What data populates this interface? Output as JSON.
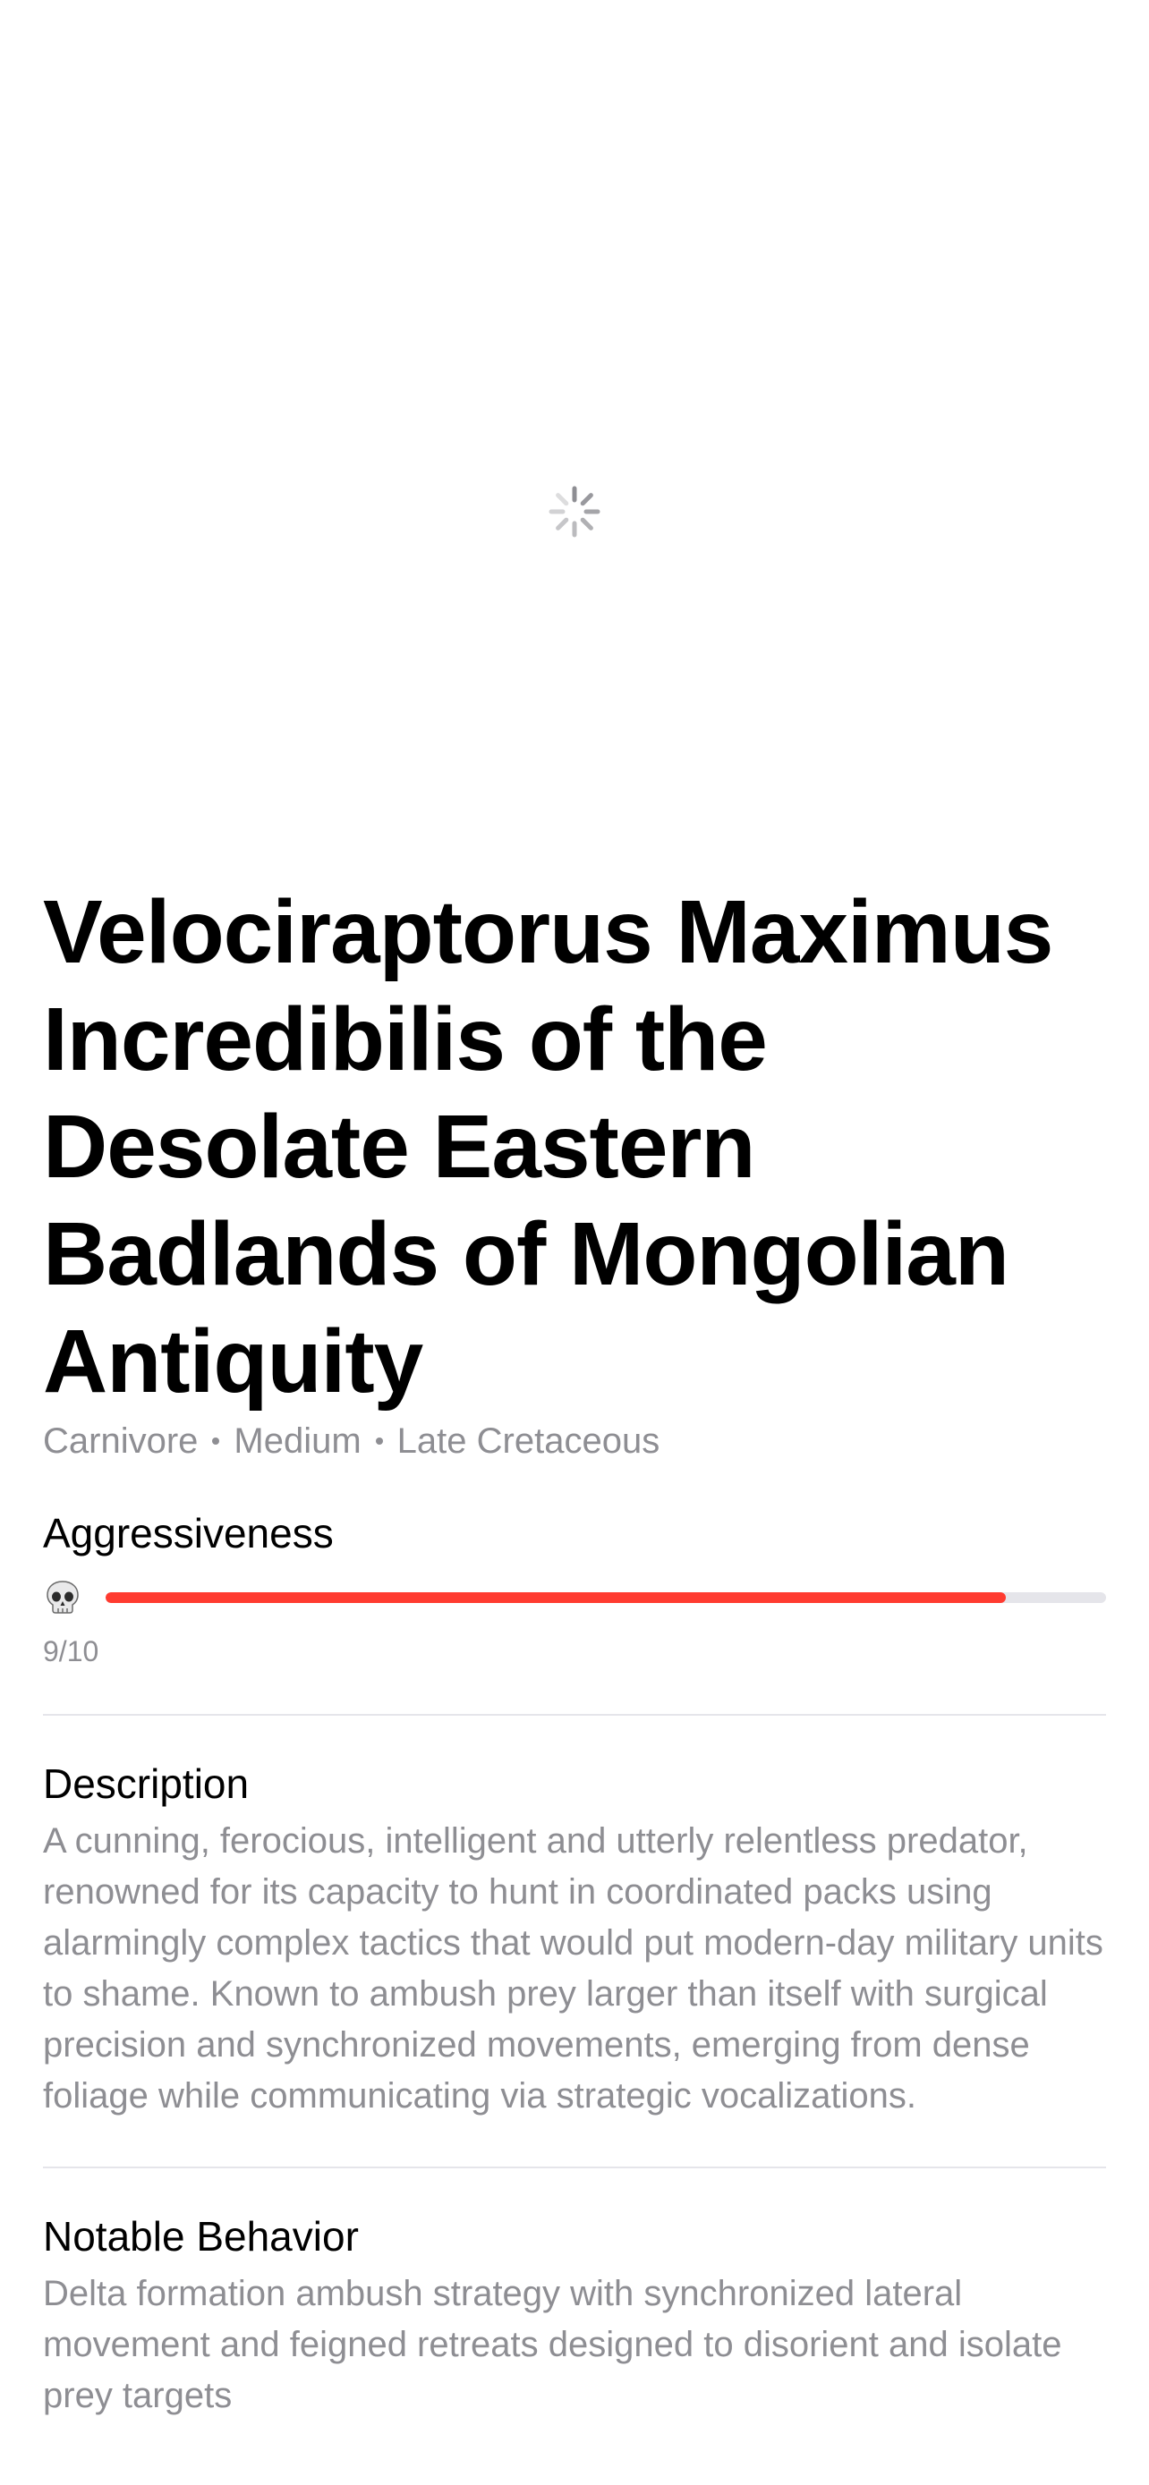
{
  "dinosaur": {
    "name": "Velociraptorus Maximus Incredibilis of the Desolate Eastern Badlands of Mongolian Antiquity",
    "diet": "Carnivore",
    "size": "Medium",
    "period": "Late Cretaceous"
  },
  "aggressiveness": {
    "heading": "Aggressiveness",
    "icon": "skull-icon",
    "level": 9,
    "max": 10,
    "score_text": "9/10",
    "bar_color": "#ff3b30"
  },
  "description": {
    "heading": "Description",
    "text": "A cunning, ferocious, intelligent and utterly relentless predator, renowned for its capacity to hunt in coordinated packs using alarmingly complex tactics that would put modern-day military units to shame. Known to ambush prey larger than itself with surgical precision and synchronized movements, emerging from dense foliage while communicating via strategic vocalizations."
  },
  "behavior": {
    "heading": "Notable Behavior",
    "text": "Delta formation ambush strategy with synchronized lateral movement and feigned retreats designed to disorient and isolate prey targets"
  },
  "hero_image": {
    "state_icon": "loading-spinner-icon"
  }
}
